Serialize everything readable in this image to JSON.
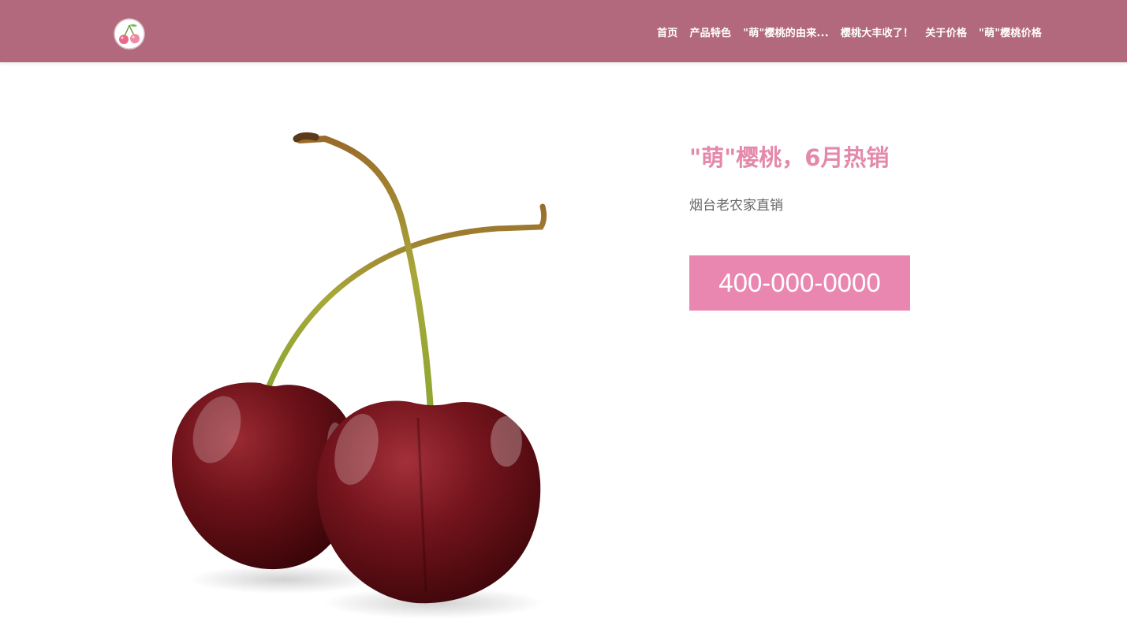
{
  "header": {
    "logo_icon": "cherry-logo-icon",
    "background_color": "#b3697d",
    "nav": [
      {
        "label": "首页"
      },
      {
        "label": "产品特色"
      },
      {
        "label": "\"萌\"樱桃的由来..."
      },
      {
        "label": "樱桃大丰收了！"
      },
      {
        "label": "关于价格"
      },
      {
        "label": "\"萌\"樱桃价格"
      }
    ]
  },
  "hero": {
    "image_icon": "cherries-image",
    "headline": "\"萌\"樱桃，6月热销",
    "headline_color": "#e489ab",
    "subtext": "烟台老农家直销",
    "phone_button_label": "400-000-0000",
    "phone_button_color": "#ea87b0"
  }
}
